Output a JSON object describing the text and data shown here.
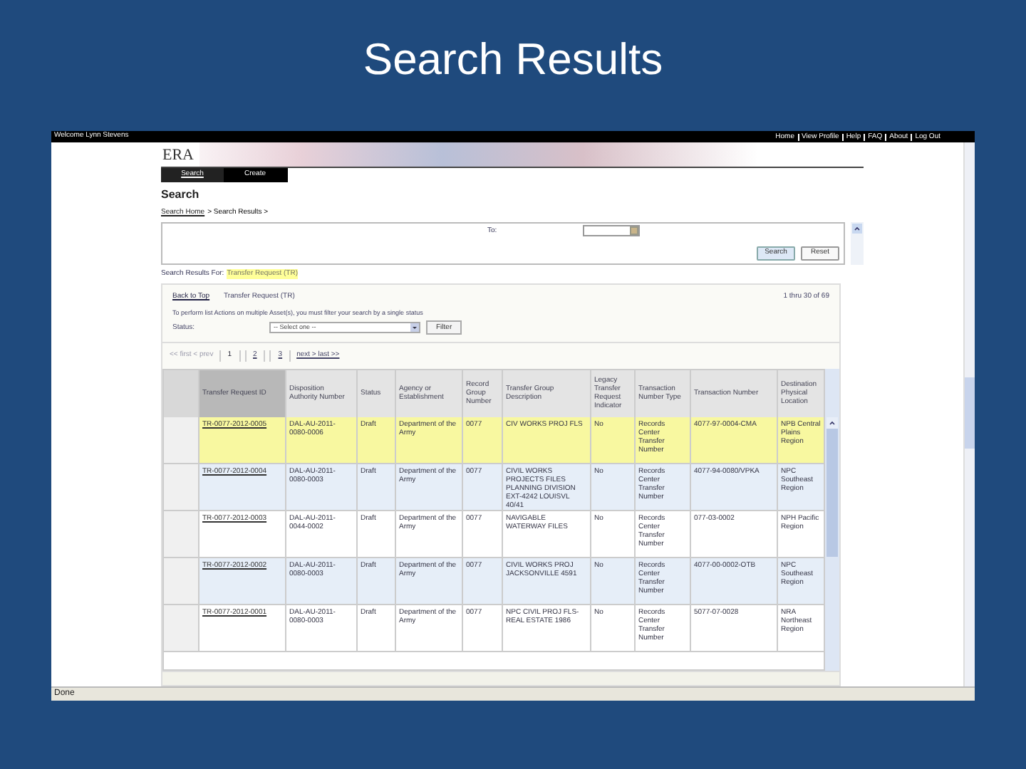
{
  "slide_title": "Search Results",
  "top_bar": {
    "welcome": "Welcome Lynn Stevens",
    "links": [
      "Home",
      "View Profile",
      "Help",
      "FAQ",
      "About",
      "Log Out"
    ]
  },
  "banner": {
    "logo": "ERA"
  },
  "tabs": [
    {
      "label": "Search",
      "selected": true
    },
    {
      "label": "Create",
      "selected": false
    }
  ],
  "page_title": "Search",
  "breadcrumb": {
    "link": "Search Home",
    "rest": "> Search Results >"
  },
  "search_panel": {
    "to_label": "To:",
    "buttons": [
      "Search",
      "Reset"
    ]
  },
  "results_for": {
    "label": "Search Results For:",
    "value": "Transfer Request (TR)"
  },
  "results_panel": {
    "back_link": "Back to Top",
    "heading": "Transfer Request (TR)",
    "count": "1 thru 30 of 69",
    "note": "To perform list Actions on multiple Asset(s), you must filter your search by a single status",
    "status_label": "Status:",
    "status_select": "-- Select one --",
    "filter_button": "Filter"
  },
  "pagination": {
    "prev": "<< first < prev",
    "pages": [
      {
        "label": "1",
        "selected": true
      },
      {
        "label": "2",
        "selected": false
      },
      {
        "label": "3",
        "selected": false
      }
    ],
    "next": "next > last >>"
  },
  "table": {
    "columns": [
      "Transfer Request ID",
      "Disposition Authority Number",
      "Status",
      "Agency or Establishment",
      "Record Group Number",
      "Transfer Group Description",
      "Legacy Transfer Request Indicator",
      "Transaction Number Type",
      "Transaction Number",
      "Destination Physical Location"
    ],
    "rows": [
      {
        "selected": true,
        "cells": [
          "TR-0077-2012-0005",
          "DAL-AU-2011-0080-0006",
          "Draft",
          "Department of the Army",
          "0077",
          "CIV WORKS PROJ FLS",
          "No",
          "Records Center Transfer Number",
          "4077-97-0004-CMA",
          "NPB Central Plains Region"
        ]
      },
      {
        "selected": false,
        "cells": [
          "TR-0077-2012-0004",
          "DAL-AU-2011-0080-0003",
          "Draft",
          "Department of the Army",
          "0077",
          "CIVIL WORKS PROJECTS FILES PLANNING DIVISION EXT-4242 LOUISVL 40/41",
          "No",
          "Records Center Transfer Number",
          "4077-94-0080/VPKA",
          "NPC Southeast Region"
        ]
      },
      {
        "selected": false,
        "cells": [
          "TR-0077-2012-0003",
          "DAL-AU-2011-0044-0002",
          "Draft",
          "Department of the Army",
          "0077",
          "NAVIGABLE WATERWAY FILES",
          "No",
          "Records Center Transfer Number",
          "077-03-0002",
          "NPH Pacific Region"
        ]
      },
      {
        "selected": false,
        "cells": [
          "TR-0077-2012-0002",
          "DAL-AU-2011-0080-0003",
          "Draft",
          "Department of the Army",
          "0077",
          "CIVIL WORKS PROJ JACKSONVILLE 4591",
          "No",
          "Records Center Transfer Number",
          "4077-00-0002-OTB",
          "NPC Southeast Region"
        ]
      },
      {
        "selected": false,
        "cells": [
          "TR-0077-2012-0001",
          "DAL-AU-2011-0080-0003",
          "Draft",
          "Department of the Army",
          "0077",
          "NPC CIVIL PROJ FLS-REAL ESTATE 1986",
          "No",
          "Records Center Transfer Number",
          "5077-07-0028",
          "NRA Northeast Region"
        ]
      }
    ]
  },
  "status_bar": "Done"
}
